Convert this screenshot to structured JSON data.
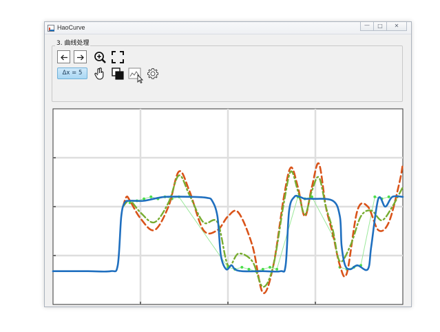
{
  "window": {
    "title": "HaoCurve"
  },
  "controls": {
    "minimize": "—",
    "maximize": "□",
    "close": "✕"
  },
  "panel": {
    "title": "3. 曲线处理"
  },
  "toolbar": {
    "back_icon": "arrow-left-icon",
    "forward_icon": "arrow-right-icon",
    "zoom_icon": "zoom-in-icon",
    "fit_icon": "fit-to-view-icon",
    "pan_icon": "hand-pan-icon",
    "copy_icon": "copy-icon",
    "curve_icon": "curve-tool-icon",
    "settings_icon": "gear-icon",
    "dx_label": "Δx = 5"
  },
  "chart_data": {
    "type": "line",
    "xlim": [
      0,
      1
    ],
    "ylim": [
      0,
      1
    ],
    "grid": true,
    "colors": {
      "blue": "#1f6fbf",
      "red": "#d95319",
      "green": "#77ac30",
      "light_green": "#4dde4d"
    },
    "series": [
      {
        "style": "solid",
        "color": "#1f6fbf",
        "x": [
          0,
          0.1,
          0.165,
          0.185,
          0.195,
          0.205,
          0.22,
          0.26,
          0.32,
          0.4,
          0.44,
          0.455,
          0.47,
          0.48,
          0.495,
          0.51,
          0.52,
          0.54,
          0.6,
          0.65,
          0.665,
          0.675,
          0.69,
          0.705,
          0.72,
          0.74,
          0.8,
          0.82,
          0.825,
          0.835,
          0.85,
          0.87,
          0.9,
          0.91,
          0.93,
          0.95,
          0.97,
          1
        ],
        "y": [
          0.17,
          0.17,
          0.17,
          0.2,
          0.45,
          0.52,
          0.53,
          0.53,
          0.55,
          0.55,
          0.545,
          0.53,
          0.45,
          0.25,
          0.18,
          0.2,
          0.18,
          0.17,
          0.17,
          0.17,
          0.2,
          0.48,
          0.55,
          0.55,
          0.54,
          0.54,
          0.53,
          0.45,
          0.3,
          0.2,
          0.18,
          0.2,
          0.18,
          0.3,
          0.54,
          0.5,
          0.55,
          0.55
        ]
      },
      {
        "style": "dashed",
        "color": "#d95319",
        "x": [
          0.2,
          0.21,
          0.22,
          0.25,
          0.29,
          0.33,
          0.36,
          0.39,
          0.43,
          0.47,
          0.5,
          0.53,
          0.57,
          0.6,
          0.63,
          0.66,
          0.68,
          0.7,
          0.72,
          0.74,
          0.76,
          0.78,
          0.8,
          0.82,
          0.84,
          0.87,
          0.9,
          0.93,
          0.96,
          0.99,
          1
        ],
        "y": [
          0.5,
          0.55,
          0.53,
          0.44,
          0.38,
          0.5,
          0.68,
          0.58,
          0.38,
          0.38,
          0.45,
          0.47,
          0.3,
          0.06,
          0.2,
          0.55,
          0.7,
          0.6,
          0.45,
          0.6,
          0.72,
          0.5,
          0.36,
          0.2,
          0.16,
          0.48,
          0.5,
          0.38,
          0.42,
          0.62,
          0.72
        ]
      },
      {
        "style": "dashdot",
        "color": "#77ac30",
        "x": [
          0.2,
          0.22,
          0.25,
          0.29,
          0.33,
          0.36,
          0.39,
          0.43,
          0.47,
          0.5,
          0.53,
          0.57,
          0.6,
          0.63,
          0.66,
          0.68,
          0.7,
          0.72,
          0.74,
          0.76,
          0.78,
          0.8,
          0.82,
          0.85,
          0.88,
          0.91,
          0.94,
          0.97,
          1
        ],
        "y": [
          0.5,
          0.53,
          0.47,
          0.42,
          0.52,
          0.66,
          0.56,
          0.42,
          0.42,
          0.2,
          0.26,
          0.22,
          0.09,
          0.2,
          0.52,
          0.68,
          0.58,
          0.46,
          0.58,
          0.65,
          0.5,
          0.38,
          0.22,
          0.3,
          0.45,
          0.48,
          0.43,
          0.5,
          0.6
        ]
      },
      {
        "style": "markers",
        "color": "#4dde4d",
        "x": [
          0.22,
          0.24,
          0.26,
          0.28,
          0.3,
          0.32,
          0.34,
          0.36,
          0.5,
          0.52,
          0.54,
          0.56,
          0.58,
          0.6,
          0.62,
          0.64,
          0.7,
          0.72,
          0.74,
          0.8,
          0.82,
          0.84,
          0.86,
          0.88,
          0.92,
          0.94,
          0.96
        ],
        "y": [
          0.52,
          0.53,
          0.54,
          0.55,
          0.54,
          0.55,
          0.54,
          0.55,
          0.19,
          0.18,
          0.19,
          0.18,
          0.17,
          0.18,
          0.19,
          0.18,
          0.55,
          0.54,
          0.55,
          0.35,
          0.19,
          0.18,
          0.19,
          0.2,
          0.55,
          0.54,
          0.55
        ]
      }
    ]
  }
}
